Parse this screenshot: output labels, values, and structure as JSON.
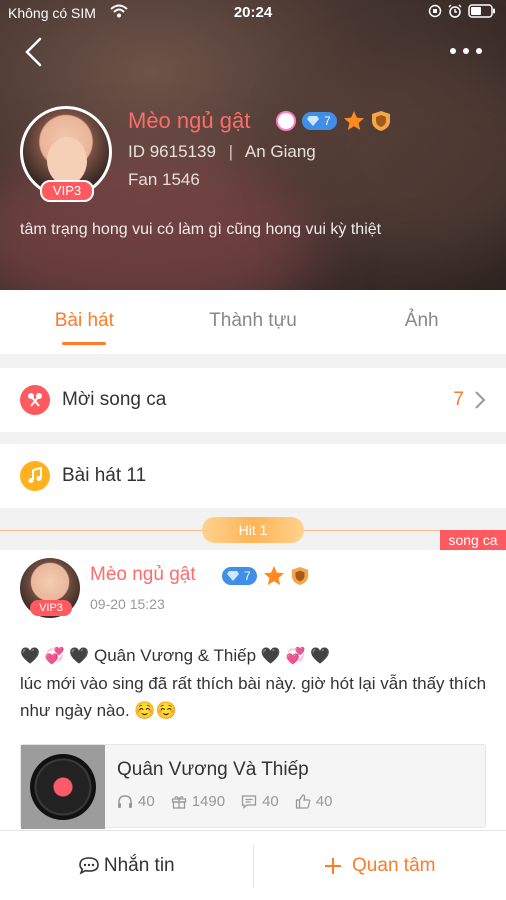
{
  "status_bar": {
    "carrier": "Không có SIM",
    "time": "20:24"
  },
  "profile": {
    "name": "Mèo ngủ gật",
    "vip_label": "VIP3",
    "diamond_level": "7",
    "id_text": "ID 9615139",
    "location": "An Giang",
    "fans": "Fan 1546",
    "bio": "tâm trạng hong vui có làm gì cũng hong vui kỳ thiệt"
  },
  "tabs": [
    {
      "label": "Bài hát",
      "active": true
    },
    {
      "label": "Thành tựu",
      "active": false
    },
    {
      "label": "Ảnh",
      "active": false
    }
  ],
  "duet_row": {
    "label": "Mời song ca",
    "count": "7"
  },
  "songs_row": {
    "label": "Bài hát 11"
  },
  "hit": {
    "label": "Hit 1",
    "tag": "song ca"
  },
  "post": {
    "author": "Mèo ngủ gật",
    "vip_label": "VIP3",
    "diamond_level": "7",
    "date": "09-20 15:23",
    "title_line": "Quân Vương & Thiếp",
    "text": "lúc mới vào sing đã rất thích bài này. giờ hót lại vẫn thấy thích như ngày nào. ☺️☺️",
    "song": {
      "title": "Quân Vương Và Thiếp",
      "listens": "40",
      "gifts": "1490",
      "comments": "40",
      "likes": "40"
    }
  },
  "bottom": {
    "message": "Nhắn tin",
    "follow": "Quan tâm"
  },
  "colors": {
    "accent": "#ff7a2a",
    "name": "#ff6b6b",
    "vip": "#ff5a5f",
    "diamond": "#3f8ee8"
  }
}
